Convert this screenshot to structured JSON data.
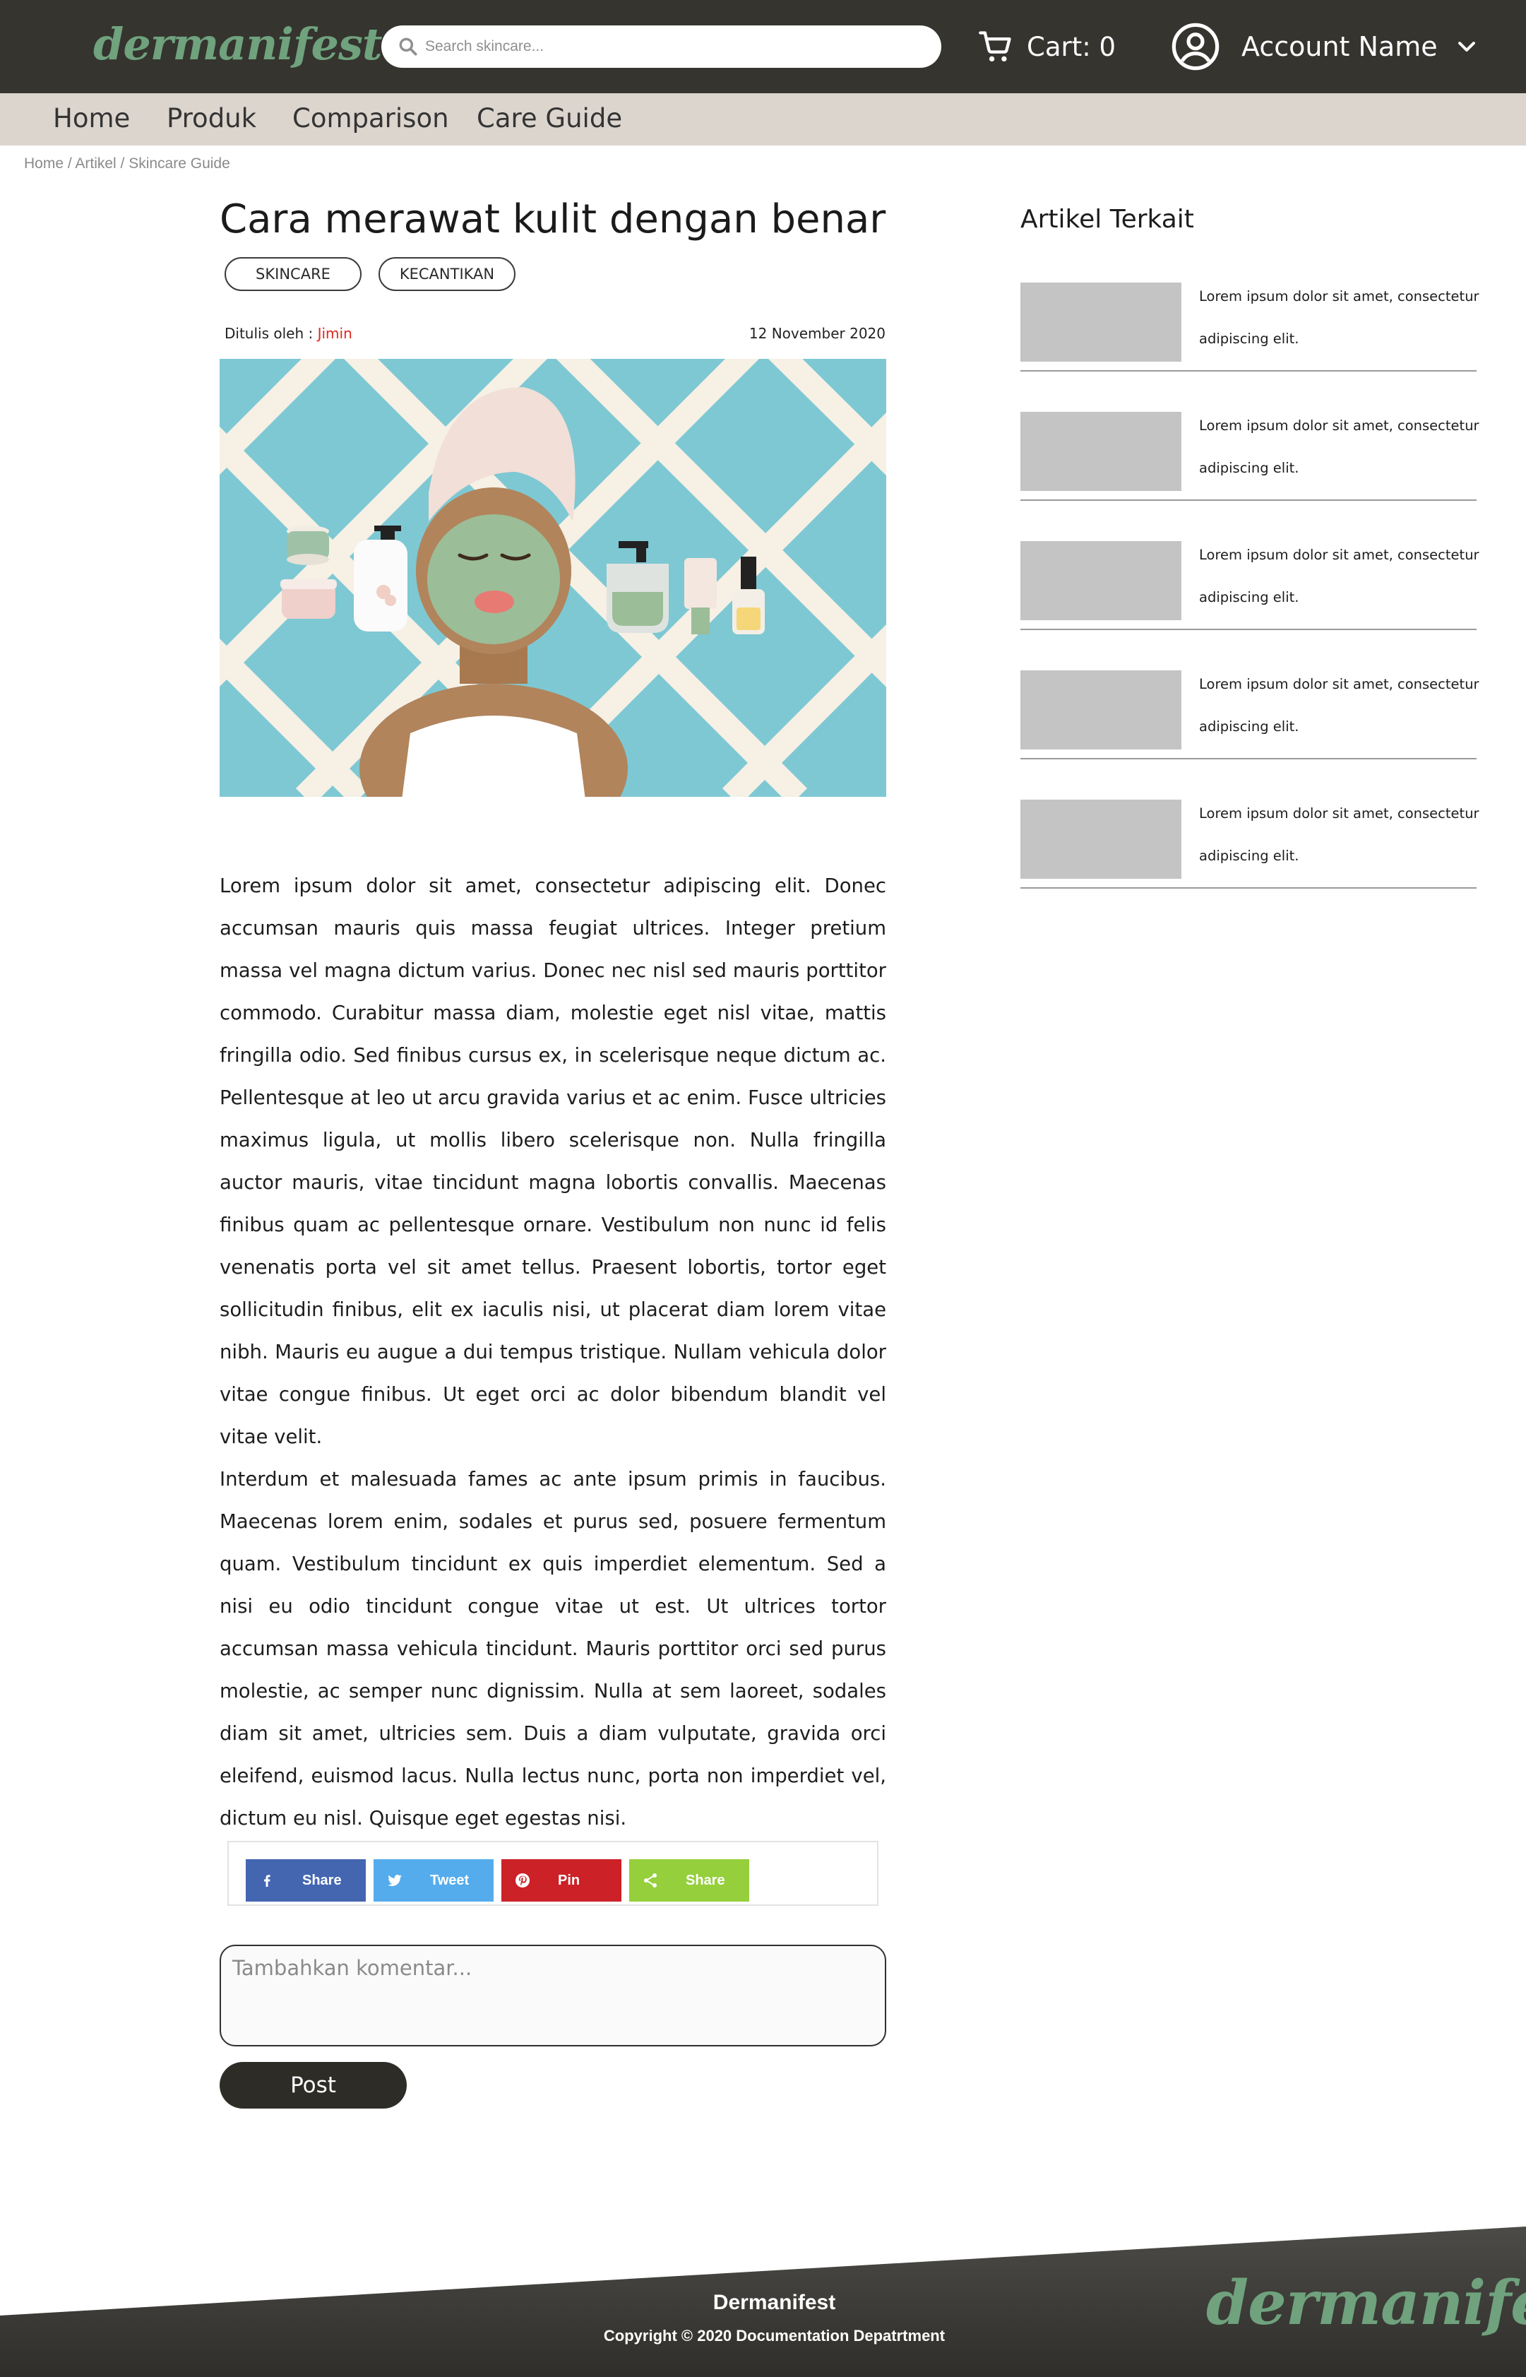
{
  "header": {
    "logo": "dermanifest",
    "search_placeholder": "Search skincare...",
    "cart_label": "Cart: 0",
    "account_name": "Account Name"
  },
  "nav": {
    "items": [
      "Home",
      "Produk",
      "Comparison",
      "Care Guide"
    ]
  },
  "breadcrumb": "Home / Artikel / Skincare Guide",
  "article": {
    "title": "Cara merawat kulit dengan benar",
    "tags": [
      "SKINCARE",
      "KECANTIKAN"
    ],
    "author_prefix": "Ditulis oleh : ",
    "author": "Jimin",
    "date": "12 November 2020",
    "paragraphs": [
      "Lorem ipsum dolor sit amet, consectetur adipiscing elit. Donec accumsan mauris quis massa feugiat ultrices. Integer pretium massa vel magna dictum varius. Donec nec nisl sed mauris porttitor commodo. Curabitur massa diam, molestie eget nisl vitae, mattis fringilla odio. Sed finibus cursus ex, in scelerisque neque dictum ac. Pellentesque at leo ut arcu gravida varius et ac enim. Fusce ultricies maximus ligula, ut mollis libero scelerisque non. Nulla fringilla auctor mauris, vitae tincidunt magna lobortis convallis. Maecenas finibus quam ac pellentesque ornare. Vestibulum non nunc id felis venenatis porta vel sit amet tellus. Praesent lobortis, tortor eget sollicitudin finibus, elit ex iaculis nisi, ut placerat diam lorem vitae nibh. Mauris eu augue a dui tempus tristique. Nullam vehicula dolor vitae congue finibus. Ut eget orci ac dolor bibendum blandit vel vitae velit.",
      "Interdum et malesuada fames ac ante ipsum primis in faucibus. Maecenas lorem enim, sodales et purus sed, posuere fermentum quam. Vestibulum tincidunt ex quis imperdiet elementum. Sed a nisi eu odio tincidunt congue vitae ut est. Ut ultrices tortor accumsan massa vehicula tincidunt. Mauris porttitor orci sed purus molestie, ac semper nunc dignissim. Nulla at sem laoreet, sodales diam sit amet, ultricies sem. Duis a diam vulputate, gravida orci eleifend, euismod lacus. Nulla lectus nunc, porta non imperdiet vel, dictum eu nisl. Quisque eget egestas nisi."
    ]
  },
  "share": {
    "buttons": [
      {
        "label": "Share",
        "icon": "facebook-icon",
        "color": "#4466b1"
      },
      {
        "label": "Tweet",
        "icon": "twitter-icon",
        "color": "#55aced"
      },
      {
        "label": "Pin",
        "icon": "pinterest-icon",
        "color": "#cc2127"
      },
      {
        "label": "Share",
        "icon": "share-icon",
        "color": "#95cf3b"
      }
    ]
  },
  "comment": {
    "placeholder": "Tambahkan komentar...",
    "post_label": "Post"
  },
  "sidebar": {
    "title": "Artikel Terkait",
    "items": [
      {
        "text": "Lorem ipsum dolor sit amet, consectetur adipiscing elit."
      },
      {
        "text": "Lorem ipsum dolor sit amet, consectetur adipiscing elit."
      },
      {
        "text": "Lorem ipsum dolor sit amet, consectetur adipiscing elit."
      },
      {
        "text": "Lorem ipsum dolor sit amet, consectetur adipiscing elit."
      },
      {
        "text": "Lorem ipsum dolor sit amet, consectetur adipiscing elit."
      }
    ]
  },
  "footer": {
    "brand": "Dermanifest",
    "copyright": "Copyright © 2020 Documentation Depatrtment",
    "logo": "dermanifest"
  },
  "colors": {
    "header_bg": "#35342f",
    "nav_bg": "#dcd5ce",
    "logo_green": "#6fa27d",
    "author_red": "#e0261d",
    "hero_bg": "#7ec8d3",
    "footer_bg": "#3a3935"
  }
}
